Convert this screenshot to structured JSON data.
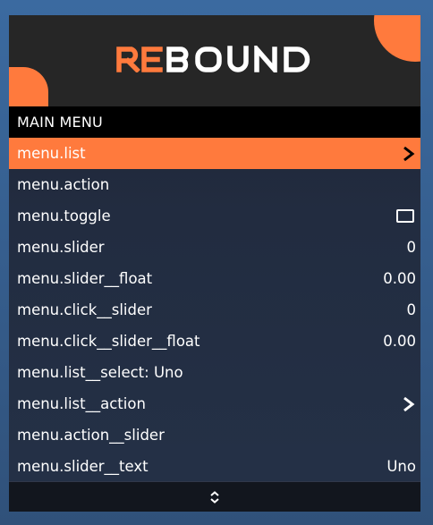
{
  "banner": {
    "logo_text": "REBOUND"
  },
  "menu": {
    "title": "MAIN MENU",
    "items": [
      {
        "label": "menu.list",
        "kind": "submenu",
        "selected": true
      },
      {
        "label": "menu.action",
        "kind": "action"
      },
      {
        "label": "menu.toggle",
        "kind": "toggle",
        "checked": false
      },
      {
        "label": "menu.slider",
        "kind": "value",
        "value": "0"
      },
      {
        "label": "menu.slider__float",
        "kind": "value",
        "value": "0.00"
      },
      {
        "label": "menu.click__slider",
        "kind": "value",
        "value": "0"
      },
      {
        "label": "menu.click__slider__float",
        "kind": "value",
        "value": "0.00"
      },
      {
        "label": "menu.list__select: Uno",
        "kind": "action"
      },
      {
        "label": "menu.list__action",
        "kind": "submenu"
      },
      {
        "label": "menu.action__slider",
        "kind": "action"
      },
      {
        "label": "menu.slider__text",
        "kind": "value",
        "value": "Uno"
      }
    ]
  },
  "footer": {
    "icon": "scroll-updown-icon"
  },
  "colors": {
    "accent": "#ff7a3d",
    "title_bar": "#000000",
    "banner": "#262626",
    "text": "#ffffff"
  }
}
